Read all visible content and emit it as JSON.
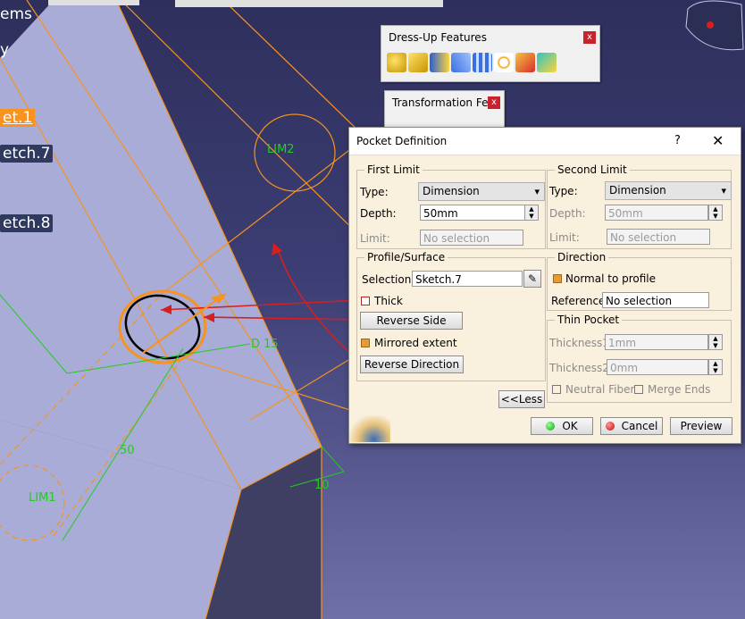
{
  "tree": {
    "items_label": "ems",
    "y_label": "y",
    "selected_node": "et.1",
    "sketch7": "etch.7",
    "sketch8": "etch.8"
  },
  "viewport": {
    "lim2": "LIM2",
    "lim1": "LIM1",
    "dim_15": "D 15",
    "dim_50": "50",
    "dim_10": "10",
    "line_color": "#f7931e",
    "dim_color": "#22cc22",
    "arrow_color": "#d42020"
  },
  "dressup_toolbar": {
    "title": "Dress-Up Features",
    "close": "x",
    "icons": [
      "fillet-icon",
      "chamfer-icon",
      "draft-icon",
      "variable-fillet-icon",
      "shell-icon",
      "thread-icon",
      "remove-face-icon",
      "replace-face-icon"
    ]
  },
  "transform_toolbar": {
    "title": "Transformation Fe...",
    "close": "x"
  },
  "dialog": {
    "title": "Pocket Definition",
    "help": "?",
    "close": "✕",
    "first_limit": {
      "legend": "First Limit",
      "type_label": "Type:",
      "type_value": "Dimension",
      "depth_label": "Depth:",
      "depth_value": "50mm",
      "limit_label": "Limit:",
      "limit_value": "No selection"
    },
    "second_limit": {
      "legend": "Second Limit",
      "type_label": "Type:",
      "type_value": "Dimension",
      "depth_label": "Depth:",
      "depth_value": "50mm",
      "limit_label": "Limit:",
      "limit_value": "No selection"
    },
    "profile": {
      "legend": "Profile/Surface",
      "selection_label": "Selection:",
      "selection_value": "Sketch.7",
      "thick_label": "Thick",
      "reverse_side": "Reverse Side",
      "mirrored_label": "Mirrored extent",
      "reverse_direction": "Reverse Direction"
    },
    "direction": {
      "legend": "Direction",
      "normal_label": "Normal to profile",
      "reference_label": "Reference:",
      "reference_value": "No selection"
    },
    "thin_pocket": {
      "legend": "Thin Pocket",
      "thickness1_label": "Thickness1:",
      "thickness1_value": "1mm",
      "thickness2_label": "Thickness2:",
      "thickness2_value": "0mm",
      "neutral_label": "Neutral Fiber",
      "merge_label": "Merge Ends"
    },
    "less_button": "<<Less",
    "ok_button": "OK",
    "cancel_button": "Cancel",
    "preview_button": "Preview"
  }
}
